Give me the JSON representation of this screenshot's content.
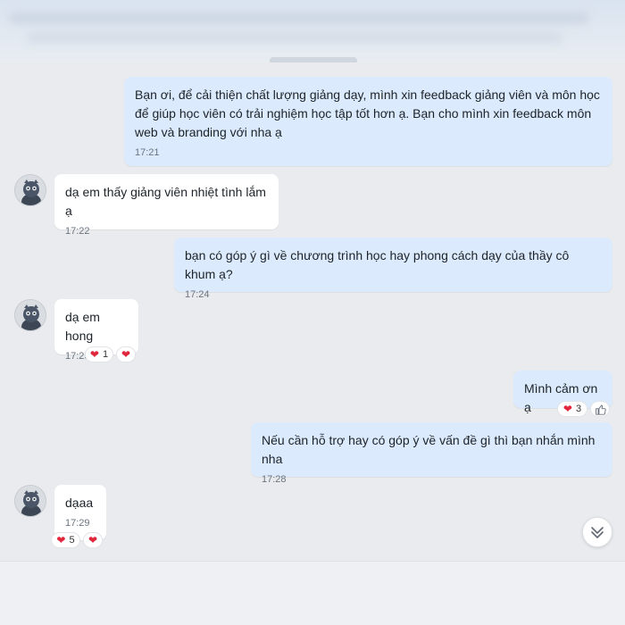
{
  "messages": [
    {
      "direction": "out",
      "text": "Bạn ơi, để cải thiện chất lượng giảng dạy, mình xin feedback giảng viên và môn học để giúp học viên có trải nghiệm học tập tốt hơn ạ. Bạn cho mình xin feedback môn web và branding với nha ạ",
      "time": "17:21"
    },
    {
      "direction": "in",
      "text": "dạ em thấy giảng viên nhiệt tình lắm ạ",
      "time": "17:22"
    },
    {
      "direction": "out",
      "text": "bạn có góp ý gì về chương trình học hay phong cách dạy của thầy cô khum ạ?",
      "time": "17:24"
    },
    {
      "direction": "in",
      "text": "dạ em hong",
      "time": "17:25",
      "reactions": {
        "summary_count": "1",
        "summary_icon": "heart-icon",
        "quick_icon": "heart-icon"
      }
    },
    {
      "direction": "out",
      "text": "Mình cảm ơn ạ",
      "reactions": {
        "summary_count": "3",
        "summary_icon": "heart-icon",
        "quick_icon": "thumbs-up-icon"
      }
    },
    {
      "direction": "out",
      "text": "Nếu cần hỗ trợ hay có góp ý về vấn đề gì thì bạn nhắn mình nha",
      "time": "17:28"
    },
    {
      "direction": "in",
      "text": "dạaa",
      "time": "17:29",
      "reactions": {
        "summary_count": "5",
        "summary_icon": "heart-icon",
        "quick_icon": "heart-icon"
      }
    }
  ],
  "colors": {
    "outgoing_bubble": "#dbeafc",
    "incoming_bubble": "#ffffff",
    "chat_background": "#e9ebee",
    "heart": "#e0263b"
  },
  "icons": {
    "scroll_down": "double-chevron-down-icon",
    "avatar": "contact-avatar"
  }
}
